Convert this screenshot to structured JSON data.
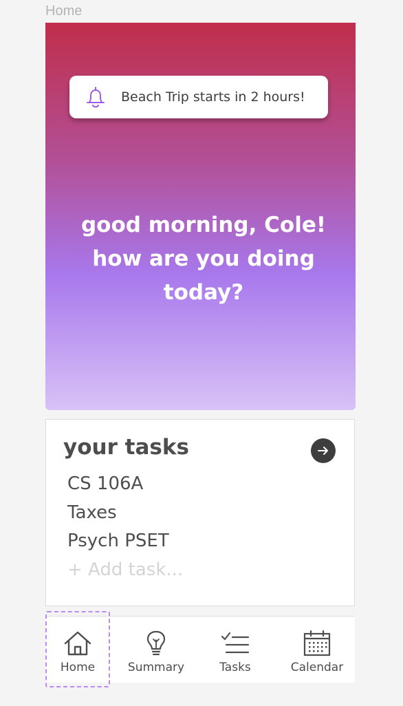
{
  "frame": {
    "label": "Home"
  },
  "notification": {
    "icon": "bell-icon",
    "text": "Beach Trip starts in 2 hours!"
  },
  "greeting": {
    "line1": "good morning, Cole!",
    "line2": "how are you doing",
    "line3": "today?"
  },
  "tasks": {
    "title": "your tasks",
    "open_icon": "arrow-right-circle-icon",
    "items": [
      {
        "label": "CS 106A"
      },
      {
        "label": "Taxes"
      },
      {
        "label": "Psych PSET"
      }
    ],
    "add_placeholder": "+ Add task..."
  },
  "nav": {
    "active": "Home",
    "items": [
      {
        "label": "Home",
        "icon": "home-icon"
      },
      {
        "label": "Summary",
        "icon": "lightbulb-icon"
      },
      {
        "label": "Tasks",
        "icon": "checklist-icon"
      },
      {
        "label": "Calendar",
        "icon": "calendar-icon"
      }
    ]
  },
  "colors": {
    "gradient_top": "#c02e4b",
    "gradient_mid": "#a878ec",
    "gradient_bottom": "#d8c2f6",
    "accent_purple": "#9b5de5",
    "text_dark": "#4d4d4d",
    "active_outline": "#b98af0"
  }
}
